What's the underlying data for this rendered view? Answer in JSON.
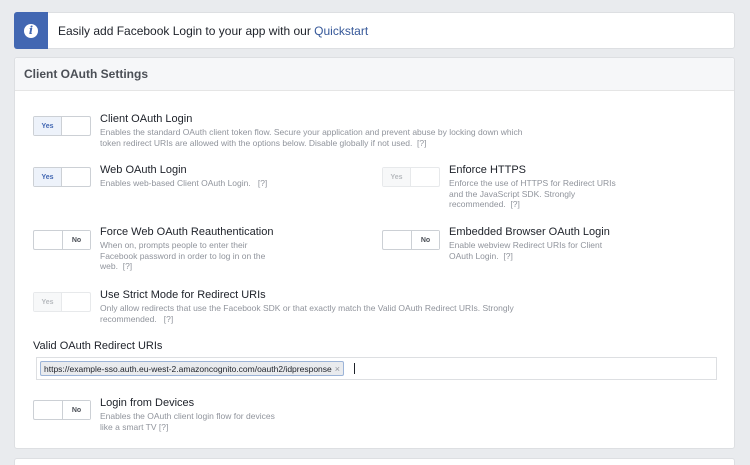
{
  "banner": {
    "text": "Easily add Facebook Login to your app with our",
    "link": "Quickstart"
  },
  "panel": {
    "title": "Client OAuth Settings"
  },
  "settings": {
    "client_oauth_login": {
      "title": "Client OAuth Login",
      "desc": "Enables the standard OAuth client token flow. Secure your application and prevent abuse by locking down which token redirect URIs are allowed with the options below. Disable globally if not used.",
      "help": "[?]",
      "value": "Yes"
    },
    "web_oauth_login": {
      "title": "Web OAuth Login",
      "desc": "Enables web-based Client OAuth Login.",
      "help": "[?]",
      "value": "Yes"
    },
    "enforce_https": {
      "title": "Enforce HTTPS",
      "desc": "Enforce the use of HTTPS for Redirect URIs and the JavaScript SDK. Strongly recommended.",
      "help": "[?]",
      "value": "Yes"
    },
    "force_reauth": {
      "title": "Force Web OAuth Reauthentication",
      "desc": "When on, prompts people to enter their Facebook password in order to log in on the web.",
      "help": "[?]",
      "value": "No"
    },
    "embedded_browser": {
      "title": "Embedded Browser OAuth Login",
      "desc": "Enable webview Redirect URIs for Client OAuth Login.",
      "help": "[?]",
      "value": "No"
    },
    "strict_mode": {
      "title": "Use Strict Mode for Redirect URIs",
      "desc": "Only allow redirects that use the Facebook SDK or that exactly match the Valid OAuth Redirect URIs. Strongly recommended.",
      "help": "[?]",
      "value": "Yes"
    },
    "login_devices": {
      "title": "Login from Devices",
      "desc": "Enables the OAuth client login flow for devices like a smart TV",
      "help": "[?]",
      "value": "No"
    }
  },
  "redirect_uris": {
    "label": "Valid OAuth Redirect URIs",
    "tokens": [
      "https://example-sso.auth.eu-west-2.amazoncognito.com/oauth2/idpresponse"
    ],
    "remove_glyph": "×"
  },
  "colors": {
    "accent": "#4267b2",
    "link": "#365899",
    "background": "#e9ebee"
  },
  "icons": {
    "banner": "info-icon"
  }
}
